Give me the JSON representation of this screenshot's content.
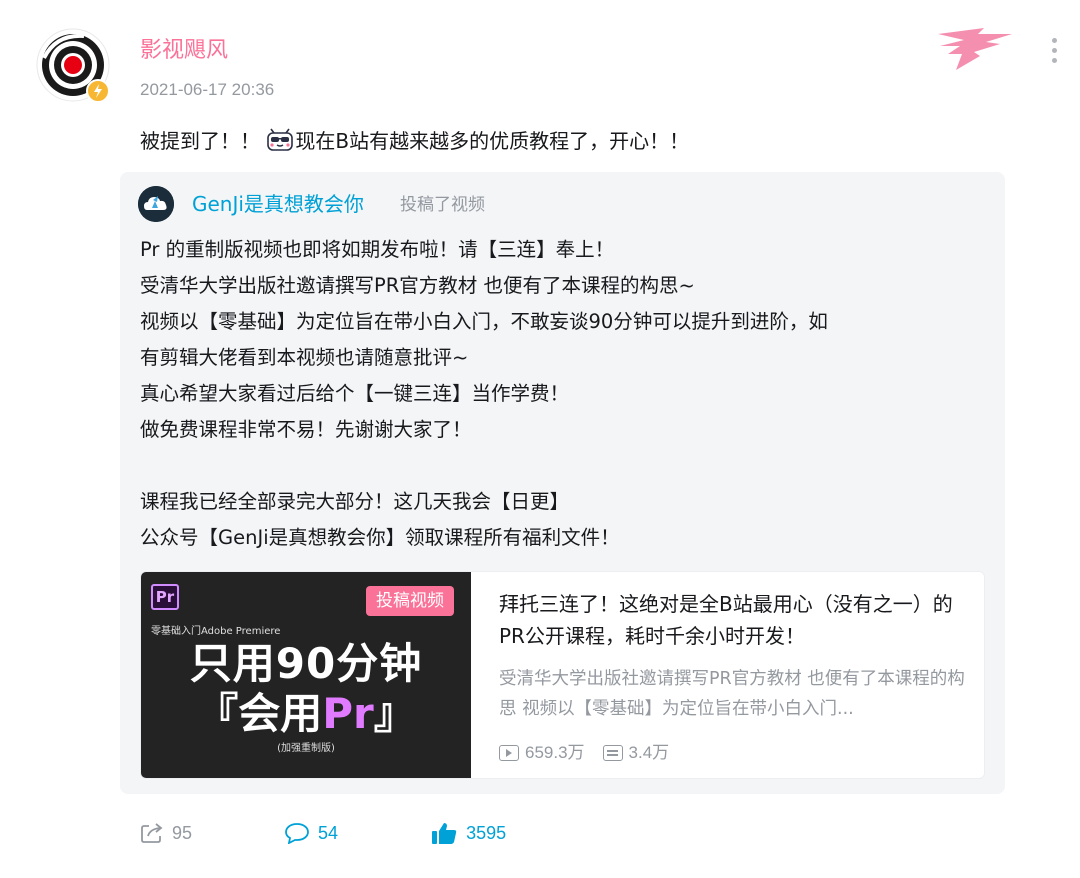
{
  "author": {
    "name": "影视飓风",
    "time": "2021-06-17 20:36",
    "avatar_icon": "target-logo-icon",
    "badge_icon": "lightning-badge-icon"
  },
  "post": {
    "text_before": "被提到了！！",
    "emote_icon": "sunglasses-tv-emote-icon",
    "text_after": "现在B站有越来越多的优质教程了，开心！！"
  },
  "original": {
    "author_name": "GenJi是真想教会你",
    "action": "投稿了视频",
    "lines": [
      "Pr 的重制版视频也即将如期发布啦！请【三连】奉上！",
      "受清华大学出版社邀请撰写PR官方教材 也便有了本课程的构思~",
      "视频以【零基础】为定位旨在带小白入门，不敢妄谈90分钟可以提升到进阶，如",
      "有剪辑大佬看到本视频也请随意批评~",
      "真心希望大家看过后给个【一键三连】当作学费！",
      "做免费课程非常不易！先谢谢大家了！",
      "",
      "课程我已经全部录完大部分！这几天我会【日更】",
      "公众号【GenJi是真想教会你】领取课程所有福利文件！"
    ]
  },
  "video": {
    "thumb_logo": "Pr",
    "thumb_badge": "投稿视频",
    "thumb_subtitle": "零基础入门Adobe Premiere",
    "thumb_title_line1": "只用90分钟",
    "thumb_title_line2_a": "『会用",
    "thumb_title_line2_b": "Pr",
    "thumb_title_line2_c": "』",
    "thumb_note": "(加强重制版)",
    "title": "拜托三连了！这绝对是全B站最用心（没有之一）的PR公开课程，耗时千余小时开发！",
    "desc": "受清华大学出版社邀请撰写PR官方教材 也便有了本课程的构思 视频以【零基础】为定位旨在带小白入门...",
    "views": "659.3万",
    "danmaku": "3.4万"
  },
  "actions": {
    "share": "95",
    "comment": "54",
    "like": "3595"
  },
  "colors": {
    "author_name": "#fb7299",
    "link_blue": "#00a1d6",
    "muted": "#9499a0",
    "card_bg": "#f4f5f7"
  }
}
